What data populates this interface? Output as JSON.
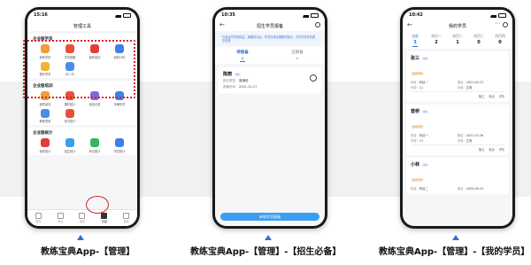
{
  "colors": {
    "accent": "#2f6fe0",
    "highlight": "#d62020",
    "button": "#3b9ef0"
  },
  "phone1": {
    "time": "15:16",
    "title": "管理工具",
    "sections": [
      {
        "title": "企业版学员",
        "items": [
          {
            "label": "我的学员",
            "icon": "person-icon",
            "color": "#f39a3a"
          },
          {
            "label": "学员报备",
            "icon": "clipboard-icon",
            "color": "#e8503a"
          },
          {
            "label": "我的培训",
            "icon": "diamond-icon",
            "color": "#e23b3b"
          },
          {
            "label": "我的计时",
            "icon": "car-icon",
            "color": "#3f7fe8"
          },
          {
            "label": "预约学车",
            "icon": "calendar-icon",
            "color": "#f3b33a"
          },
          {
            "label": "约一约",
            "icon": "chat-icon",
            "color": "#4a8ee8"
          }
        ]
      },
      {
        "title": "企业版培训",
        "items": [
          {
            "label": "我的培训",
            "icon": "book-icon",
            "color": "#f39a3a"
          },
          {
            "label": "课时统计",
            "icon": "chart-icon",
            "color": "#e8503a"
          },
          {
            "label": "培训记录",
            "icon": "record-icon",
            "color": "#8c63e0"
          },
          {
            "label": "车辆情况",
            "icon": "car-icon",
            "color": "#3f7fe8"
          },
          {
            "label": "教练签到",
            "icon": "pin-icon",
            "color": "#4a8ee8"
          },
          {
            "label": "考试统计",
            "icon": "exam-icon",
            "color": "#e8503a"
          }
        ]
      },
      {
        "title": "企业版统计",
        "items": [
          {
            "label": "我的统计",
            "icon": "stat-icon",
            "color": "#e23b3b"
          },
          {
            "label": "招生统计",
            "icon": "people-icon",
            "color": "#3aa0e8"
          },
          {
            "label": "考试统计",
            "icon": "doc-icon",
            "color": "#2fb85f"
          },
          {
            "label": "学员统计",
            "icon": "list-icon",
            "color": "#3f7fe8"
          }
        ]
      }
    ],
    "tabs": [
      {
        "label": "首页",
        "icon": "home-icon"
      },
      {
        "label": "学员",
        "icon": "student-icon"
      },
      {
        "label": "发现",
        "icon": "discover-icon"
      },
      {
        "label": "管理",
        "icon": "manage-icon"
      },
      {
        "label": "我的",
        "icon": "profile-icon"
      }
    ],
    "caption": "教练宝典App-【管理】"
  },
  "phone2": {
    "time": "10:35",
    "title": "招生学员报备",
    "notice": "为保证学员的权益，报备成功后，学员在规定期限内报名，方可在学员列表中查看",
    "tabs": [
      {
        "label": "待报备",
        "count": "1"
      },
      {
        "label": "已报备",
        "count": "0"
      }
    ],
    "card": {
      "name": "陈丽",
      "tag": "C1",
      "rows": [
        {
          "k": "报名类型",
          "v": "普通班"
        },
        {
          "k": "报备时间",
          "v": "2021-12-27"
        }
      ]
    },
    "button": "新增学员报备",
    "caption": "教练宝典App-【管理】-【招生必备】"
  },
  "phone3": {
    "time": "10:42",
    "title": "我的学员",
    "tabs": [
      {
        "label": "全部",
        "count": "3"
      },
      {
        "label": "科目一",
        "count": "2"
      },
      {
        "label": "科目二",
        "count": "1"
      },
      {
        "label": "科目三",
        "count": "0"
      },
      {
        "label": "科目四",
        "count": "0"
      }
    ],
    "students": [
      {
        "name": "张三",
        "tag": "C1",
        "status": "在培学员",
        "rows": [
          [
            "科目：",
            "科目一",
            "报名：",
            "2021-05-13"
          ],
          [
            "车型：",
            "C1",
            "状态：",
            "正常"
          ]
        ],
        "actions": [
          "备注",
          "电话",
          "详情"
        ]
      },
      {
        "name": "普桥",
        "tag": "C1",
        "status": "在培学员",
        "rows": [
          [
            "科目：",
            "科目一",
            "报名：",
            "2021-07-26"
          ],
          [
            "车型：",
            "C1",
            "状态：",
            "正常"
          ]
        ],
        "actions": [
          "备注",
          "电话",
          "详情"
        ]
      },
      {
        "name": "小林",
        "tag": "C1",
        "status": "在培学员",
        "rows": [
          [
            "科目：",
            "科目二",
            "报名：",
            "2020-09-24"
          ]
        ],
        "actions": []
      }
    ],
    "caption": "教练宝典App-【管理】-【我的学员】"
  }
}
